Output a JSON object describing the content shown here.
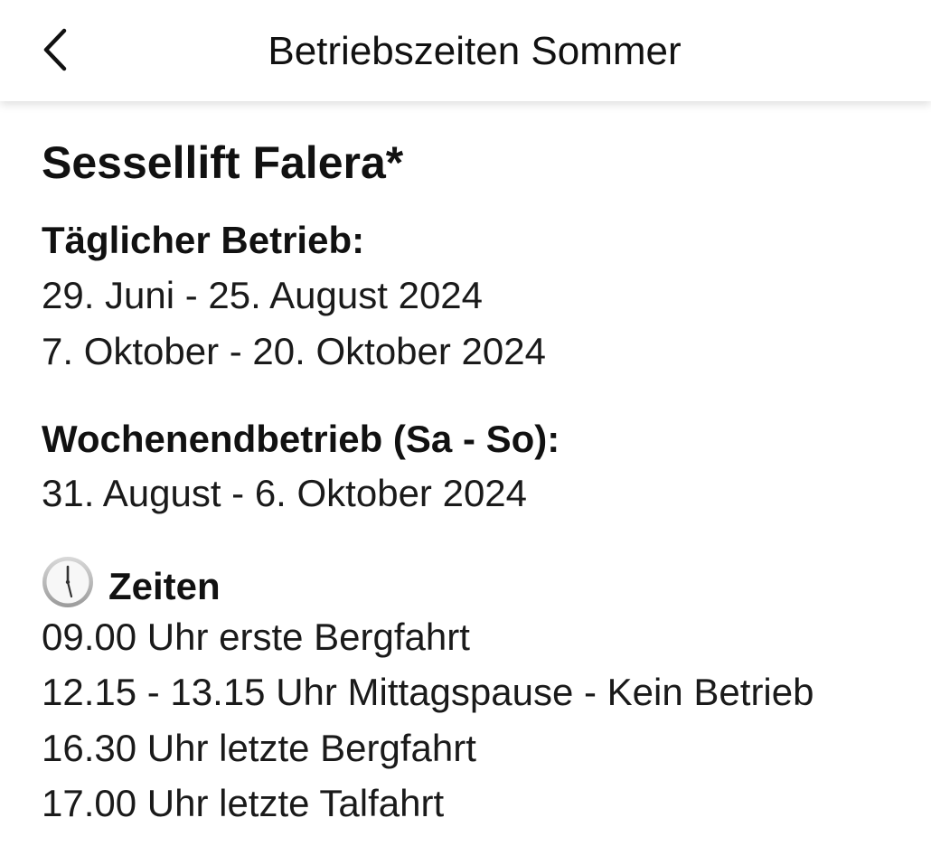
{
  "nav": {
    "title": "Betriebszeiten Sommer",
    "back_icon": "chevron-left-icon"
  },
  "content": {
    "heading": "Sessellift Falera*",
    "daily": {
      "label": "Täglicher Betrieb:",
      "lines": [
        "29. Juni - 25. August 2024",
        "7. Oktober - 20. Oktober 2024"
      ]
    },
    "weekend": {
      "label": "Wochenendbetrieb (Sa - So):",
      "lines": [
        "31. August - 6. Oktober 2024"
      ]
    },
    "times": {
      "icon": "clock-icon",
      "label": "Zeiten",
      "lines": [
        "09.00 Uhr erste Bergfahrt",
        "12.15 - 13.15 Uhr Mittagspause - Kein Betrieb",
        "16.30 Uhr letzte Bergfahrt",
        "17.00 Uhr letzte Talfahrt"
      ]
    }
  },
  "colors": {
    "text": "#111111",
    "background": "#ffffff"
  }
}
